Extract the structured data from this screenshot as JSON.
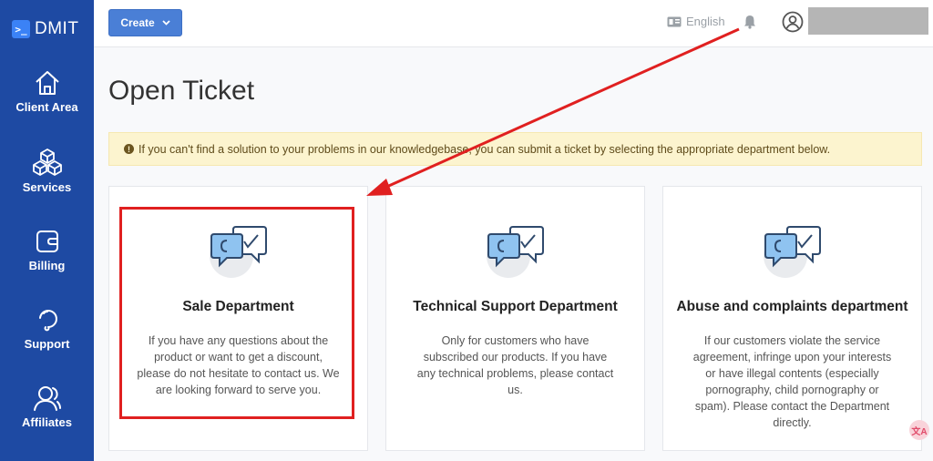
{
  "brand": {
    "mark": ">_",
    "name": "DMIT"
  },
  "sidebar": {
    "items": [
      {
        "label": "Client Area",
        "icon": "home-icon"
      },
      {
        "label": "Services",
        "icon": "cubes-icon"
      },
      {
        "label": "Billing",
        "icon": "wallet-icon"
      },
      {
        "label": "Support",
        "icon": "support-icon"
      },
      {
        "label": "Affiliates",
        "icon": "users-icon"
      }
    ]
  },
  "topbar": {
    "create_label": "Create",
    "language": "English"
  },
  "page": {
    "title": "Open Ticket",
    "alert": "If you can't find a solution to your problems in our knowledgebase, you can submit a ticket by selecting the appropriate department below."
  },
  "departments": [
    {
      "title": "Sale Department",
      "description": "If you have any questions about the product or want to get a discount, please do not hesitate to contact us. We are looking forward to serve you."
    },
    {
      "title": "Technical Support Department",
      "description": "Only for customers who have subscribed our products. If you have any technical problems, please contact us."
    },
    {
      "title": "Abuse and complaints department",
      "description": "If our customers violate the service agreement, infringe upon your interests or have illegal contents (especially pornography, child pornography or spam). Please contact the Department directly."
    }
  ],
  "colors": {
    "sidebar": "#1e4aa3",
    "accent": "#4a7fd6",
    "annotation": "#e02020",
    "alert_bg": "#fcf4cf"
  }
}
